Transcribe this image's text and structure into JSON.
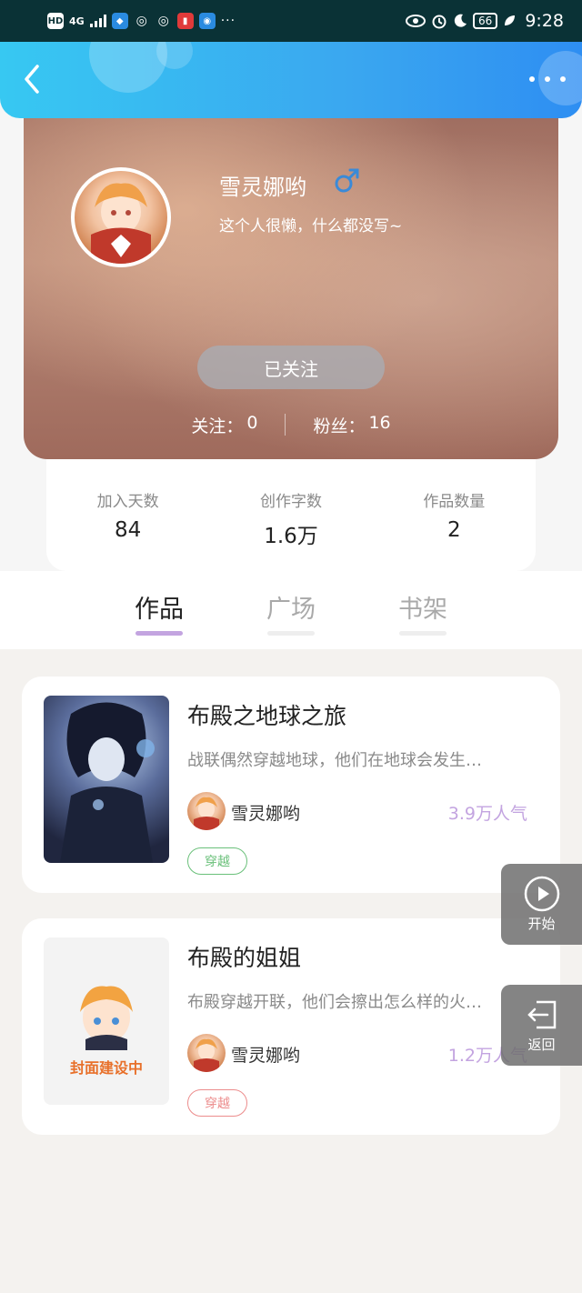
{
  "status_bar": {
    "network_label": "HD",
    "signal_label": "4G",
    "battery_level": "66",
    "time": "9:28",
    "icons": [
      "hd-icon",
      "signal-icon",
      "shield-app-icon",
      "wechat-icon",
      "wechat-icon",
      "red-app-icon",
      "blue-app-icon",
      "more-dots-icon",
      "eye-icon",
      "alarm-icon",
      "moon-icon",
      "battery-icon",
      "leaf-icon"
    ]
  },
  "header": {
    "back_icon": "chevron-left-icon",
    "more_icon": "more-dots-icon",
    "gradient_colors": [
      "#37c8f2",
      "#2e8ef2"
    ]
  },
  "profile": {
    "name": "雪灵娜哟",
    "gender_icon": "male-icon",
    "bio": "这个人很懒，什么都没写~",
    "follow_button": "已关注",
    "following_label": "关注：",
    "following_count": "0",
    "fans_label": "粉丝：",
    "fans_count": "16"
  },
  "stats": [
    {
      "label": "加入天数",
      "value": "84"
    },
    {
      "label": "创作字数",
      "value": "1.6万"
    },
    {
      "label": "作品数量",
      "value": "2"
    }
  ],
  "tabs": [
    {
      "label": "作品",
      "active": true
    },
    {
      "label": "广场",
      "active": false
    },
    {
      "label": "书架",
      "active": false
    }
  ],
  "works": [
    {
      "title": "布殿之地球之旅",
      "description": "战联偶然穿越地球，他们在地球会发生…",
      "author": "雪灵娜哟",
      "popularity": "3.9万人气",
      "tag": "穿越"
    },
    {
      "title": "布殿的姐姐",
      "description": "布殿穿越开联，他们会擦出怎么样的火…",
      "author": "雪灵娜哟",
      "popularity": "1.2万人气",
      "tag": "穿越",
      "cover_text": "封面建设中"
    }
  ],
  "floating": {
    "start_label": "开始",
    "back_label": "返回"
  },
  "colors": {
    "accent_purple": "#c3a4e0",
    "tag_green": "#6ac07a",
    "tag_red": "#ec8c8c"
  }
}
